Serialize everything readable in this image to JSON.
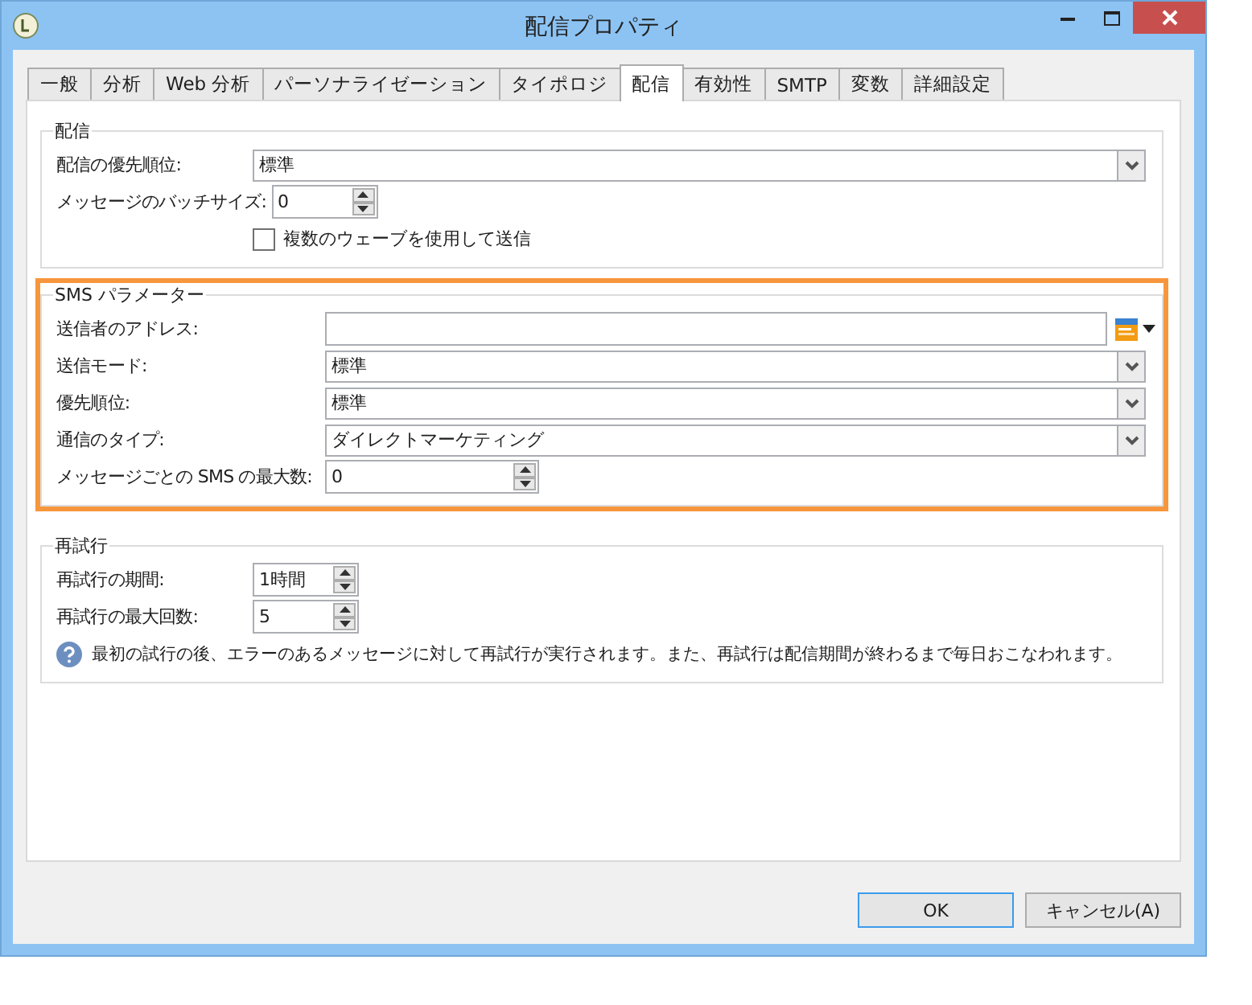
{
  "window": {
    "title": "配信プロパティ"
  },
  "tabs": [
    {
      "label": "一般",
      "selected": false
    },
    {
      "label": "分析",
      "selected": false
    },
    {
      "label": "Web 分析",
      "selected": false
    },
    {
      "label": "パーソナライゼーション",
      "selected": false
    },
    {
      "label": "タイポロジ",
      "selected": false
    },
    {
      "label": "配信",
      "selected": true
    },
    {
      "label": "有効性",
      "selected": false
    },
    {
      "label": "SMTP",
      "selected": false
    },
    {
      "label": "変数",
      "selected": false
    },
    {
      "label": "詳細設定",
      "selected": false
    }
  ],
  "delivery": {
    "title": "配信",
    "fields": [
      {
        "kind": "select",
        "label": "配信の優先順位:",
        "value": "標準"
      },
      {
        "kind": "spin",
        "label": "メッセージのバッチサイズ:",
        "value": "0"
      },
      {
        "kind": "checkbox",
        "label": "複数のウェーブを使用して送信",
        "checked": false
      }
    ]
  },
  "sms": {
    "title": "SMS パラメーター",
    "highlighted": true,
    "fields": [
      {
        "kind": "address",
        "label": "送信者のアドレス:"
      },
      {
        "kind": "select",
        "label": "送信モード:",
        "value": "標準"
      },
      {
        "kind": "select",
        "label": "優先順位:",
        "value": "標準"
      },
      {
        "kind": "select",
        "label": "通信のタイプ:",
        "value": "ダイレクトマーケティング"
      },
      {
        "kind": "spin",
        "label": "メッセージごとの SMS の最大数:",
        "value": "0"
      }
    ]
  },
  "retry": {
    "title": "再試行",
    "fields": [
      {
        "kind": "spin",
        "label": "再試行の期間:",
        "value": "1時間"
      },
      {
        "kind": "spin",
        "label": "再試行の最大回数:",
        "value": "5"
      },
      {
        "kind": "info",
        "label": "最初の試行の後、エラーのあるメッセージに対して再試行が実行されます。また、再試行は配信期間が終わるまで毎日おこなわれます。"
      }
    ]
  },
  "buttons": [
    {
      "label": "OK",
      "default": true
    },
    {
      "label": "キャンセル(A)",
      "default": false
    }
  ]
}
